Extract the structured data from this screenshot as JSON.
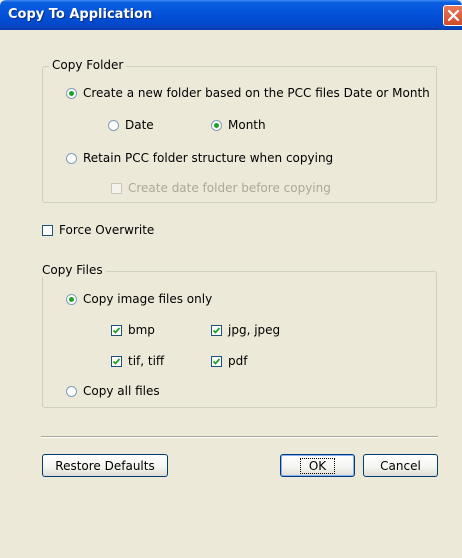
{
  "window": {
    "title": "Copy To Application"
  },
  "copy_folder": {
    "legend": "Copy Folder",
    "option_new_folder": "Create a new folder based on the PCC files Date or Month",
    "option_date": "Date",
    "option_month": "Month",
    "option_retain": "Retain PCC folder structure when copying",
    "option_date_folder": "Create date folder before copying"
  },
  "force_overwrite": {
    "label": "Force Overwrite",
    "checked": false
  },
  "copy_files": {
    "legend": "Copy Files",
    "option_image_only": "Copy image files only",
    "types": {
      "bmp": "bmp",
      "jpg": "jpg, jpeg",
      "tif": "tif, tiff",
      "pdf": "pdf"
    },
    "option_all": "Copy all files"
  },
  "buttons": {
    "restore_defaults": "Restore Defaults",
    "ok": "OK",
    "cancel": "Cancel"
  },
  "colors": {
    "titlebar": "#0250d8",
    "dialog_bg": "#ece9d8",
    "radio_selected": "#21a121"
  }
}
